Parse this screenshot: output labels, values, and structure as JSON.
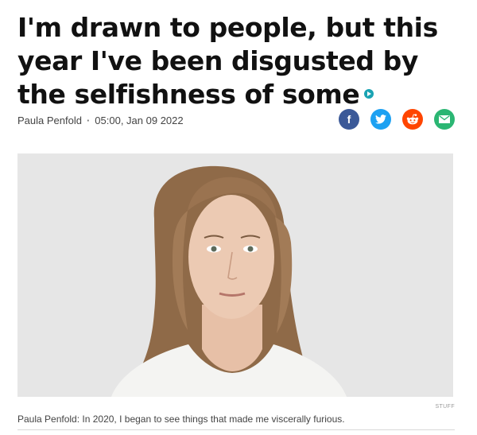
{
  "article": {
    "headline": "I'm drawn to people, but this year I've been disgusted by the selfishness of some",
    "author": "Paula Penfold",
    "separator": "·",
    "timestamp": "05:00, Jan 09 2022",
    "photo_credit": "STUFF",
    "caption": "Paula Penfold: In 2020, I began to see things that made me viscerally furious."
  },
  "share": {
    "facebook": "f",
    "twitter": "twitter-icon",
    "reddit": "reddit-icon",
    "email": "email-icon"
  },
  "colors": {
    "facebook": "#3b5998",
    "twitter": "#1da1f2",
    "reddit": "#ff4500",
    "email": "#2bb673",
    "accent": "#1aa3b3"
  }
}
